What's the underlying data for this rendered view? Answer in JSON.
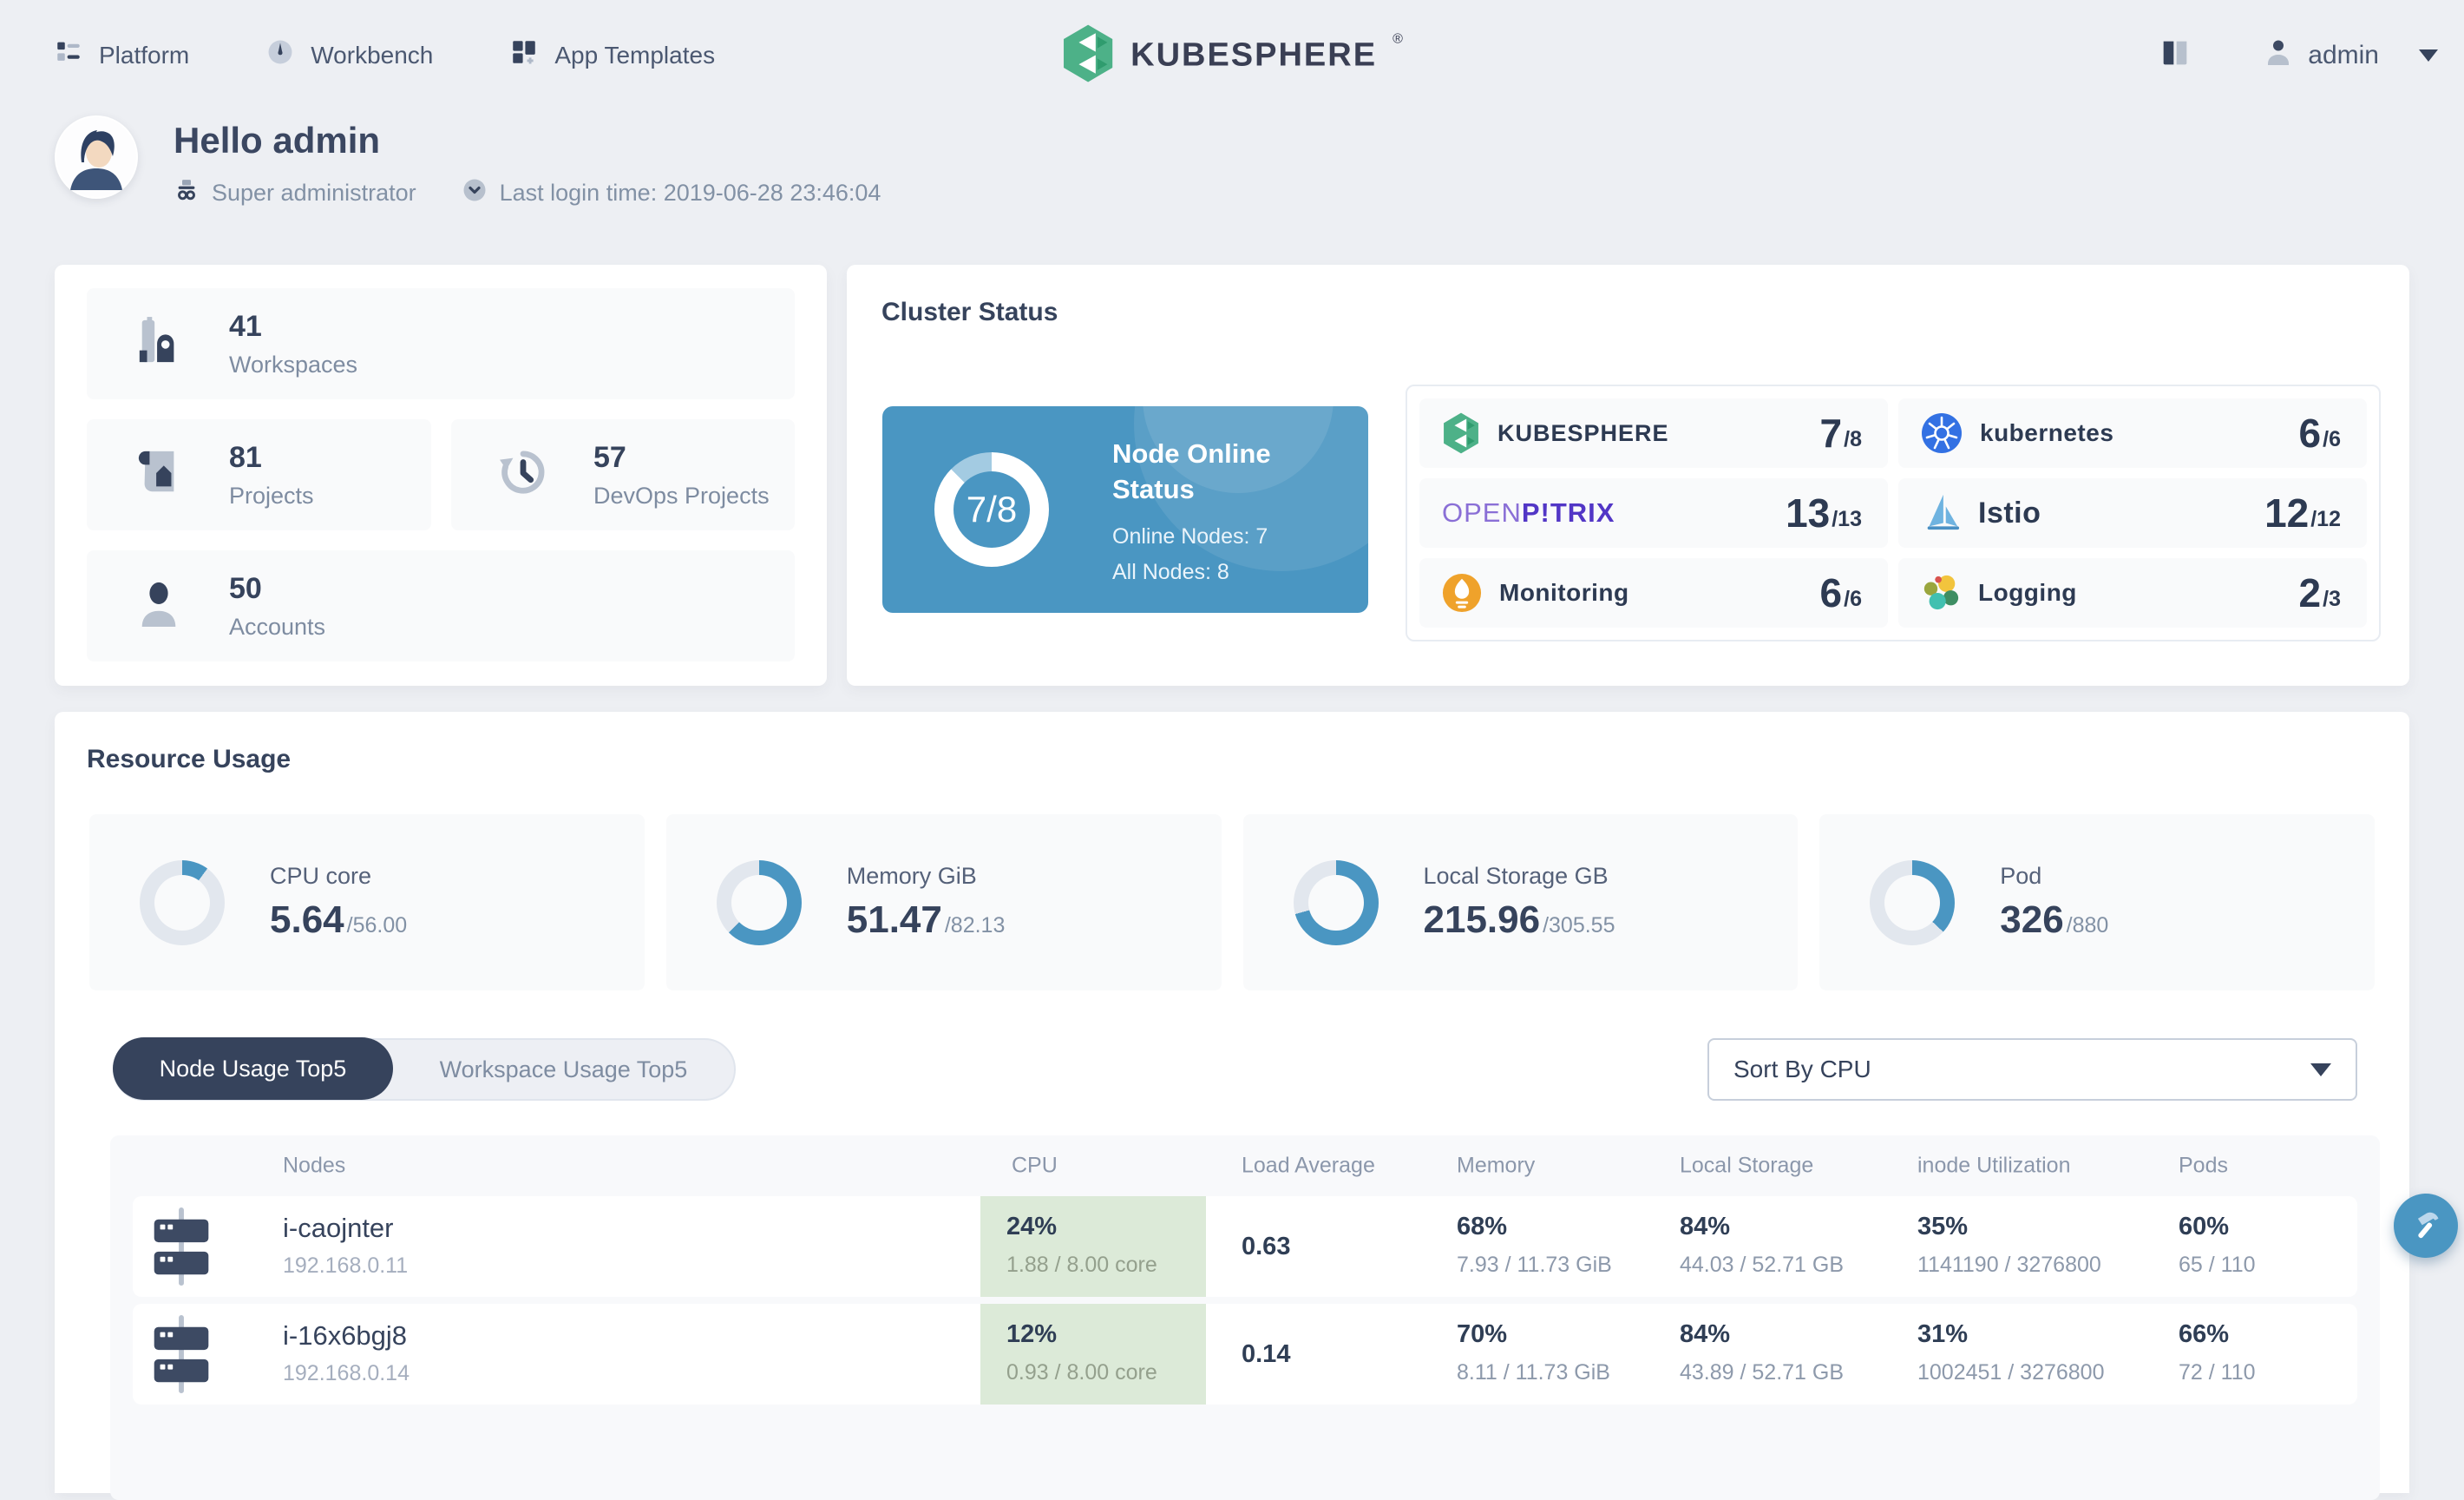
{
  "colors": {
    "accent_blue": "#4a96c2",
    "donut_track": "#e2e7ee",
    "node_online_track": "#a3cbe2",
    "tab_active_bg": "#36435c",
    "cpu_cell_bg": "#dcead8",
    "brand_green": "#4db188",
    "page_bg": "#edeff3"
  },
  "nav": {
    "items": [
      {
        "label": "Platform",
        "icon": "platform-icon"
      },
      {
        "label": "Workbench",
        "icon": "workbench-icon"
      },
      {
        "label": "App Templates",
        "icon": "app-templates-icon"
      }
    ],
    "brand": "KUBESPHERE",
    "brand_mark": "®",
    "docs_icon": "docs-book-icon",
    "user": {
      "name": "admin",
      "icon": "user-icon"
    }
  },
  "header": {
    "greeting": "Hello admin",
    "role": "Super administrator",
    "last_login": "Last login time: 2019-06-28 23:46:04"
  },
  "overview": {
    "stats": [
      {
        "value": "41",
        "label": "Workspaces",
        "icon": "workspaces-icon"
      },
      {
        "value": "81",
        "label": "Projects",
        "icon": "projects-icon"
      },
      {
        "value": "57",
        "label": "DevOps Projects",
        "icon": "devops-projects-icon"
      },
      {
        "value": "50",
        "label": "Accounts",
        "icon": "accounts-icon"
      }
    ]
  },
  "cluster_status": {
    "title": "Cluster Status",
    "node_online": {
      "ratio": "7/8",
      "percent": 87.5,
      "title": "Node Online Status",
      "online_nodes": "Online Nodes: 7",
      "all_nodes": "All Nodes: 8"
    },
    "components": [
      {
        "name": "KUBESPHERE",
        "value": "7",
        "total": "/8",
        "icon": "kubesphere-logo"
      },
      {
        "name": "kubernetes",
        "value": "6",
        "total": "/6",
        "icon": "kubernetes-logo"
      },
      {
        "name_open": "OPEN",
        "name_pitrix": "P!TRIX",
        "value": "13",
        "total": "/13",
        "icon": "openpitrix-logo"
      },
      {
        "name": "Istio",
        "value": "12",
        "total": "/12",
        "icon": "istio-logo"
      },
      {
        "name": "Monitoring",
        "value": "6",
        "total": "/6",
        "icon": "monitoring-logo"
      },
      {
        "name": "Logging",
        "value": "2",
        "total": "/3",
        "icon": "logging-logo"
      }
    ]
  },
  "resource_usage": {
    "title": "Resource Usage",
    "gauges": [
      {
        "label": "CPU core",
        "used": "5.64",
        "total": "/56.00",
        "percent": 10.1
      },
      {
        "label": "Memory GiB",
        "used": "51.47",
        "total": "/82.13",
        "percent": 62.7
      },
      {
        "label": "Local Storage GB",
        "used": "215.96",
        "total": "/305.55",
        "percent": 70.7
      },
      {
        "label": "Pod",
        "used": "326",
        "total": "/880",
        "percent": 37.0
      }
    ],
    "tabs": [
      {
        "label": "Node Usage Top5",
        "active": true
      },
      {
        "label": "Workspace Usage Top5",
        "active": false
      }
    ],
    "sort": {
      "value": "Sort By CPU"
    },
    "table": {
      "columns": [
        "Nodes",
        "CPU",
        "Load Average",
        "Memory",
        "Local Storage",
        "inode Utilization",
        "Pods"
      ],
      "rows": [
        {
          "name": "i-caojnter",
          "ip": "192.168.0.11",
          "cpu": {
            "percent": "24%",
            "detail": "1.88 / 8.00 core"
          },
          "load": "0.63",
          "memory": {
            "percent": "68%",
            "detail": "7.93 / 11.73 GiB"
          },
          "storage": {
            "percent": "84%",
            "detail": "44.03 / 52.71 GB"
          },
          "inode": {
            "percent": "35%",
            "detail": "1141190 / 3276800"
          },
          "pods": {
            "percent": "60%",
            "detail": "65 / 110"
          }
        },
        {
          "name": "i-16x6bgj8",
          "ip": "192.168.0.14",
          "cpu": {
            "percent": "12%",
            "detail": "0.93 / 8.00 core"
          },
          "load": "0.14",
          "memory": {
            "percent": "70%",
            "detail": "8.11 / 11.73 GiB"
          },
          "storage": {
            "percent": "84%",
            "detail": "43.89 / 52.71 GB"
          },
          "inode": {
            "percent": "31%",
            "detail": "1002451 / 3276800"
          },
          "pods": {
            "percent": "66%",
            "detail": "72 / 110"
          }
        }
      ]
    }
  },
  "fab": {
    "icon": "toolbox-hammer-icon"
  }
}
